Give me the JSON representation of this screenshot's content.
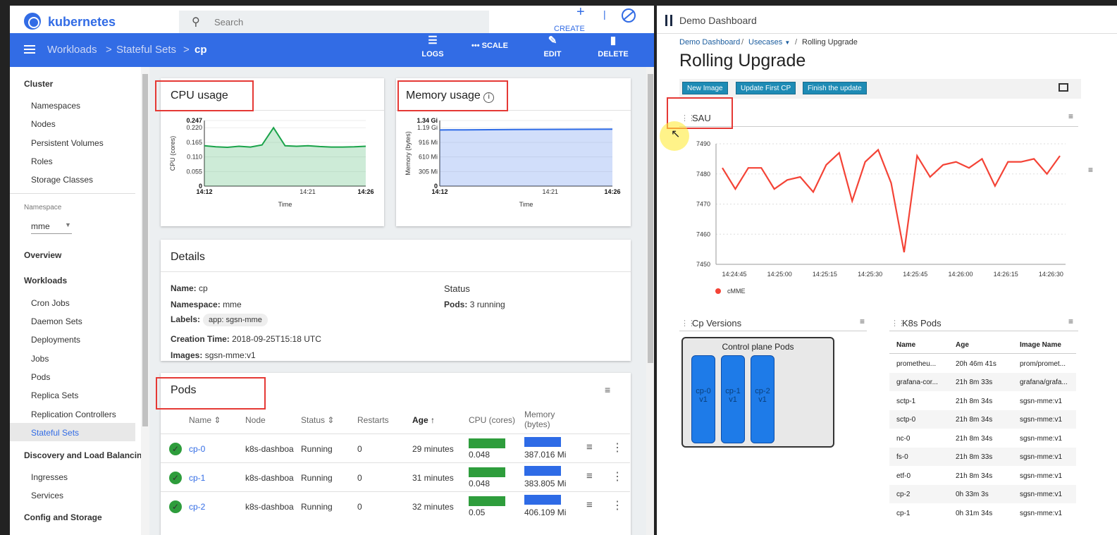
{
  "k8s": {
    "brand": "kubernetes",
    "search_placeholder": "Search",
    "create_label": "CREATE",
    "breadcrumb": [
      "Workloads",
      "Stateful Sets",
      "cp"
    ],
    "breadcrumb_sep": ">",
    "actions": {
      "logs": "LOGS",
      "scale": "SCALE",
      "edit": "EDIT",
      "delete": "DELETE"
    },
    "sidebar": {
      "cluster": "Cluster",
      "cluster_items": [
        "Namespaces",
        "Nodes",
        "Persistent Volumes",
        "Roles",
        "Storage Classes"
      ],
      "namespace_label": "Namespace",
      "namespace_value": "mme",
      "overview": "Overview",
      "workloads": "Workloads",
      "workload_items": [
        "Cron Jobs",
        "Daemon Sets",
        "Deployments",
        "Jobs",
        "Pods",
        "Replica Sets",
        "Replication Controllers",
        "Stateful Sets"
      ],
      "discovery": "Discovery and Load Balancing",
      "discovery_items": [
        "Ingresses",
        "Services"
      ],
      "config": "Config and Storage"
    },
    "cpu_card": {
      "title": "CPU usage",
      "ylabel": "CPU (cores)",
      "xlabel": "Time",
      "yticks": [
        "0.247",
        "0.220",
        "0.165",
        "0.110",
        "0.055",
        "0"
      ],
      "xticks": [
        "14:12",
        "14:21",
        "14:26"
      ]
    },
    "mem_card": {
      "title": "Memory usage",
      "ylabel": "Memory (bytes)",
      "xlabel": "Time",
      "yticks": [
        "1.34 Gi",
        "1.19 Gi",
        "916 Mi",
        "610 Mi",
        "305 Mi",
        "0"
      ],
      "xticks": [
        "14:12",
        "14:21",
        "14:26"
      ]
    },
    "details": {
      "title": "Details",
      "name_label": "Name:",
      "name": "cp",
      "ns_label": "Namespace:",
      "ns": "mme",
      "labels_label": "Labels:",
      "label_chip": "app: sgsn-mme",
      "creation_label": "Creation Time:",
      "creation": "2018-09-25T15:18 UTC",
      "images_label": "Images:",
      "images": "sgsn-mme:v1",
      "status_title": "Status",
      "pods_label": "Pods:",
      "pods": "3 running"
    },
    "pods": {
      "title": "Pods",
      "headers": [
        "Name",
        "Node",
        "Status",
        "Restarts",
        "Age",
        "CPU (cores)",
        "Memory (bytes)"
      ],
      "rows": [
        {
          "name": "cp-0",
          "node": "k8s-dashboa",
          "status": "Running",
          "restarts": "0",
          "age": "29 minutes",
          "cpu": "0.048",
          "mem": "387.016 Mi"
        },
        {
          "name": "cp-1",
          "node": "k8s-dashboa",
          "status": "Running",
          "restarts": "0",
          "age": "31 minutes",
          "cpu": "0.048",
          "mem": "383.805 Mi"
        },
        {
          "name": "cp-2",
          "node": "k8s-dashboa",
          "status": "Running",
          "restarts": "0",
          "age": "32 minutes",
          "cpu": "0.05",
          "mem": "406.109 Mi"
        }
      ]
    }
  },
  "dash": {
    "title": "Demo Dashboard",
    "breadcrumb": [
      "Demo Dashboard",
      "Usecases",
      "Rolling Upgrade"
    ],
    "heading": "Rolling Upgrade",
    "buttons": [
      "New Image",
      "Update First CP",
      "Finish the update"
    ],
    "sau_title": "SAU",
    "cp_versions_title": "Cp Versions",
    "control_plane_title": "Control plane Pods",
    "cp_pods": [
      {
        "name": "cp-0",
        "ver": "v1"
      },
      {
        "name": "cp-1",
        "ver": "v1"
      },
      {
        "name": "cp-2",
        "ver": "v1"
      }
    ],
    "k8s_pods_title": "K8s Pods",
    "k8s_pods_headers": [
      "Name",
      "Age",
      "Image Name"
    ],
    "k8s_pods_rows": [
      [
        "prometheu...",
        "20h 46m 41s",
        "prom/promet..."
      ],
      [
        "grafana-cor...",
        "21h 8m 33s",
        "grafana/grafa..."
      ],
      [
        "sctp-1",
        "21h 8m 34s",
        "sgsn-mme:v1"
      ],
      [
        "sctp-0",
        "21h 8m 34s",
        "sgsn-mme:v1"
      ],
      [
        "nc-0",
        "21h 8m 34s",
        "sgsn-mme:v1"
      ],
      [
        "fs-0",
        "21h 8m 33s",
        "sgsn-mme:v1"
      ],
      [
        "etf-0",
        "21h 8m 34s",
        "sgsn-mme:v1"
      ],
      [
        "cp-2",
        "0h 33m 3s",
        "sgsn-mme:v1"
      ],
      [
        "cp-1",
        "0h 31m 34s",
        "sgsn-mme:v1"
      ]
    ]
  },
  "chart_data": [
    {
      "type": "area",
      "title": "CPU usage",
      "xlabel": "Time",
      "ylabel": "CPU (cores)",
      "x": [
        "14:12",
        "14:13",
        "14:14",
        "14:15",
        "14:16",
        "14:17",
        "14:18",
        "14:19",
        "14:20",
        "14:21",
        "14:22",
        "14:23",
        "14:24",
        "14:25",
        "14:26"
      ],
      "values": [
        0.152,
        0.148,
        0.146,
        0.15,
        0.147,
        0.155,
        0.22,
        0.152,
        0.15,
        0.152,
        0.149,
        0.147,
        0.147,
        0.148,
        0.15
      ],
      "ylim": [
        0,
        0.247
      ],
      "color": "#1aa34a"
    },
    {
      "type": "area",
      "title": "Memory usage",
      "xlabel": "Time",
      "ylabel": "Memory (bytes)",
      "y_unit": "Mi",
      "x": [
        "14:12",
        "14:14",
        "14:16",
        "14:18",
        "14:20",
        "14:22",
        "14:24",
        "14:26"
      ],
      "values": [
        1175,
        1177,
        1180,
        1183,
        1186,
        1188,
        1190,
        1192
      ],
      "ylim": [
        0,
        1372
      ],
      "color": "#2e6be6"
    },
    {
      "type": "line",
      "title": "SAU",
      "series": [
        {
          "name": "cMME",
          "color": "#f44336",
          "values": [
            7482,
            7475,
            7482,
            7482,
            7475,
            7478,
            7479,
            7474,
            7483,
            7487,
            7471,
            7484,
            7488,
            7477,
            7454,
            7486,
            7479,
            7483,
            7484,
            7482,
            7485,
            7476,
            7484,
            7484,
            7485,
            7480,
            7486
          ]
        }
      ],
      "xticks": [
        "14:24:45",
        "14:25:00",
        "14:25:15",
        "14:25:30",
        "14:25:45",
        "14:26:00",
        "14:26:15",
        "14:26:30"
      ],
      "yticks": [
        "7490",
        "7480",
        "7470",
        "7460",
        "7450"
      ],
      "ylim": [
        7450,
        7490
      ],
      "legend": "bottom-left"
    }
  ]
}
